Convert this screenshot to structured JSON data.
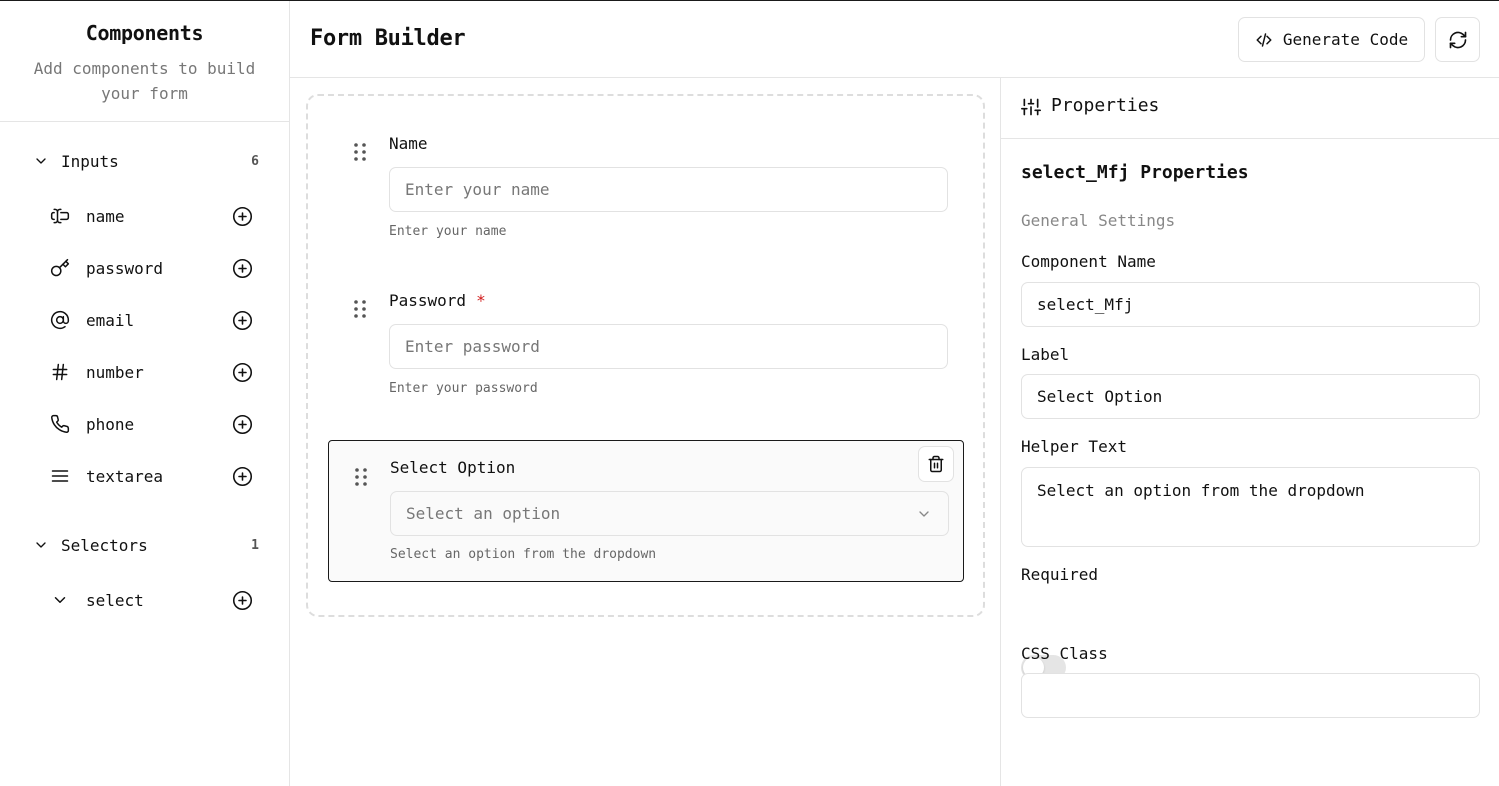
{
  "sidebar": {
    "title": "Components",
    "subtitle": "Add components to build your form",
    "groups": [
      {
        "label": "Inputs",
        "count": "6",
        "items": [
          {
            "label": "name",
            "icon": "text-cursor-icon"
          },
          {
            "label": "password",
            "icon": "key-icon"
          },
          {
            "label": "email",
            "icon": "at-sign-icon"
          },
          {
            "label": "number",
            "icon": "hash-icon"
          },
          {
            "label": "phone",
            "icon": "phone-icon"
          },
          {
            "label": "textarea",
            "icon": "align-justify-icon"
          }
        ]
      },
      {
        "label": "Selectors",
        "count": "1",
        "items": [
          {
            "label": "select",
            "icon": "chevron-down-icon"
          }
        ]
      }
    ]
  },
  "header": {
    "title": "Form Builder",
    "generate_label": "Generate Code"
  },
  "form": {
    "fields": [
      {
        "label": "Name",
        "placeholder": "Enter your name",
        "helper": "Enter your name",
        "required": false
      },
      {
        "label": "Password",
        "placeholder": "Enter password",
        "helper": "Enter your password",
        "required": true,
        "required_mark": "*"
      },
      {
        "label": "Select Option",
        "placeholder": "Select an option",
        "helper": "Select an option from the dropdown",
        "selected": true
      }
    ]
  },
  "properties": {
    "title": "Properties",
    "heading": "select_Mfj Properties",
    "section": "General Settings",
    "component_name_label": "Component Name",
    "component_name_value": "select_Mfj",
    "label_label": "Label",
    "label_value": "Select Option",
    "helper_label": "Helper Text",
    "helper_value": "Select an option from the dropdown",
    "required_label": "Required",
    "required_value": false,
    "css_label": "CSS Class",
    "css_value": ""
  },
  "colors": {
    "required_mark": "#d11a1a",
    "border": "#e2e2e2",
    "selected_border": "#1a1a1a"
  }
}
